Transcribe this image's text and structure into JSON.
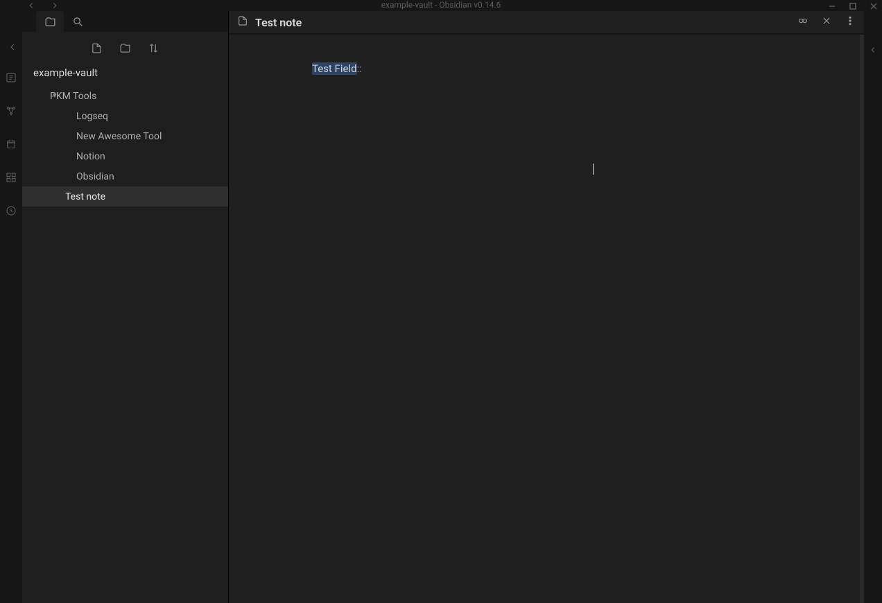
{
  "window": {
    "title": "example-vault - Obsidian v0.14.6"
  },
  "vault": {
    "name": "example-vault"
  },
  "fileTree": {
    "folder": "PKM Tools",
    "items": [
      "Logseq",
      "New Awesome Tool",
      "Notion",
      "Obsidian"
    ],
    "rootFiles": [
      "Test note"
    ],
    "activeFile": "Test note"
  },
  "editor": {
    "title": "Test note",
    "fieldKey": "Test Field",
    "fieldSep": "::"
  }
}
